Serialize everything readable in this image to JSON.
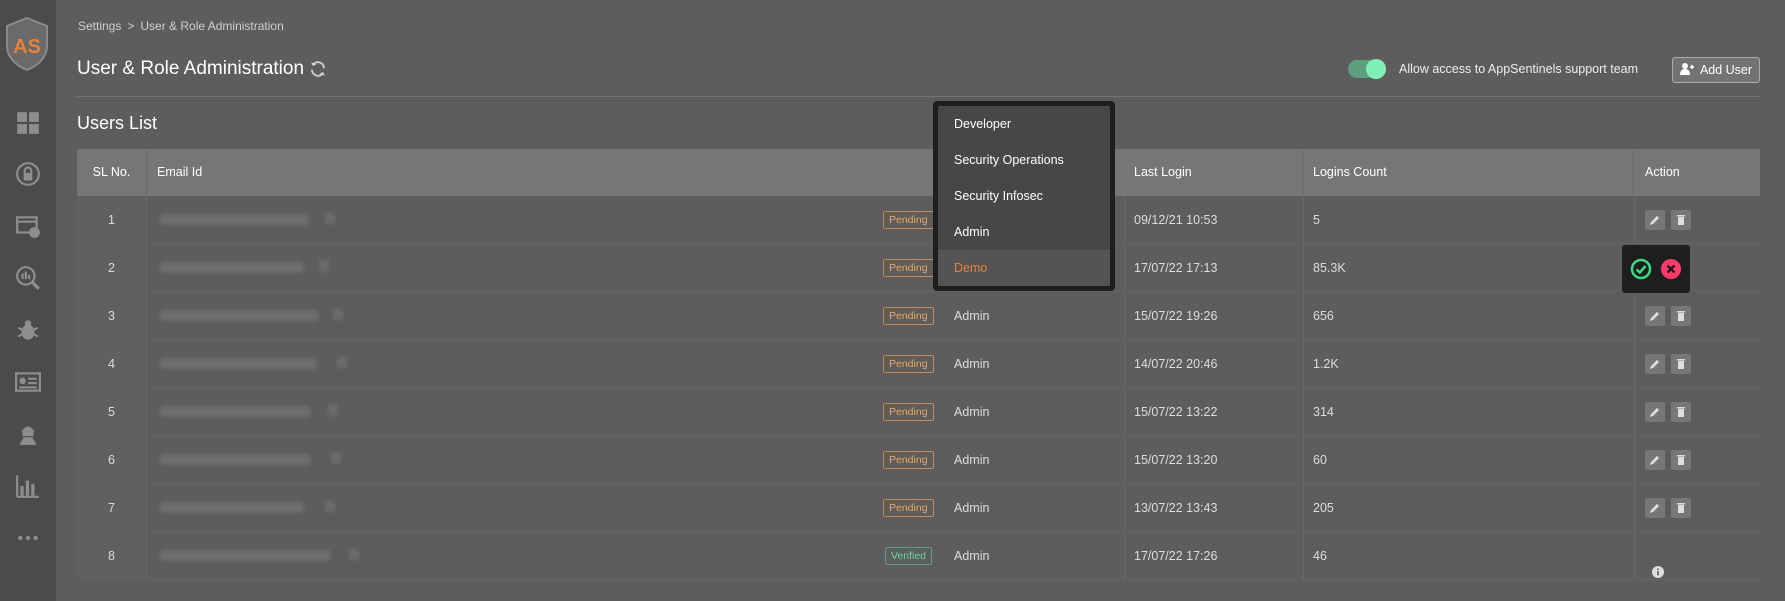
{
  "breadcrumb": {
    "root": "Settings",
    "separator": ">",
    "current": "User & Role Administration"
  },
  "header": {
    "title": "User & Role Administration",
    "support_toggle_label": "Allow access to AppSentinels support team",
    "support_toggle_on": true,
    "add_user_label": "Add User"
  },
  "section_title": "Users List",
  "table": {
    "columns": [
      "SL No.",
      "Email Id",
      "Last Login",
      "Logins Count",
      "Action"
    ],
    "rows": [
      {
        "sl": "1",
        "status": "Pending",
        "role": "",
        "last_login": "09/12/21 10:53",
        "count": "5"
      },
      {
        "sl": "2",
        "status": "Pending",
        "role": "",
        "last_login": "17/07/22 17:13",
        "count": "85.3K"
      },
      {
        "sl": "3",
        "status": "Pending",
        "role": "Admin",
        "last_login": "15/07/22 19:26",
        "count": "656"
      },
      {
        "sl": "4",
        "status": "Pending",
        "role": "Admin",
        "last_login": "14/07/22 20:46",
        "count": "1.2K"
      },
      {
        "sl": "5",
        "status": "Pending",
        "role": "Admin",
        "last_login": "15/07/22 13:22",
        "count": "314"
      },
      {
        "sl": "6",
        "status": "Pending",
        "role": "Admin",
        "last_login": "15/07/22 13:20",
        "count": "60"
      },
      {
        "sl": "7",
        "status": "Pending",
        "role": "Admin",
        "last_login": "13/07/22 13:43",
        "count": "205"
      },
      {
        "sl": "8",
        "status": "Verified",
        "role": "Admin",
        "last_login": "17/07/22 17:26",
        "count": "46"
      }
    ]
  },
  "role_dropdown": {
    "options": [
      "Developer",
      "Security Operations",
      "Security Infosec",
      "Admin",
      "Demo"
    ],
    "selected": "Demo"
  },
  "colors": {
    "accent": "#e8823a",
    "pending": "#e8a766",
    "verified": "#6ed69b",
    "confirm": "#3ddc84",
    "cancel": "#ff3b6b",
    "toggle": "#7ff0b6"
  },
  "icons": {
    "sidebar": [
      "dashboard-icon",
      "lock-icon",
      "api-icon",
      "search-analytics-icon",
      "bug-icon",
      "id-card-icon",
      "hacker-icon",
      "bar-chart-icon",
      "more-icon"
    ],
    "row_actions": [
      "edit-icon",
      "delete-icon"
    ],
    "confirm": [
      "confirm-check-icon",
      "cancel-x-icon"
    ],
    "verified_action": "info-icon"
  }
}
